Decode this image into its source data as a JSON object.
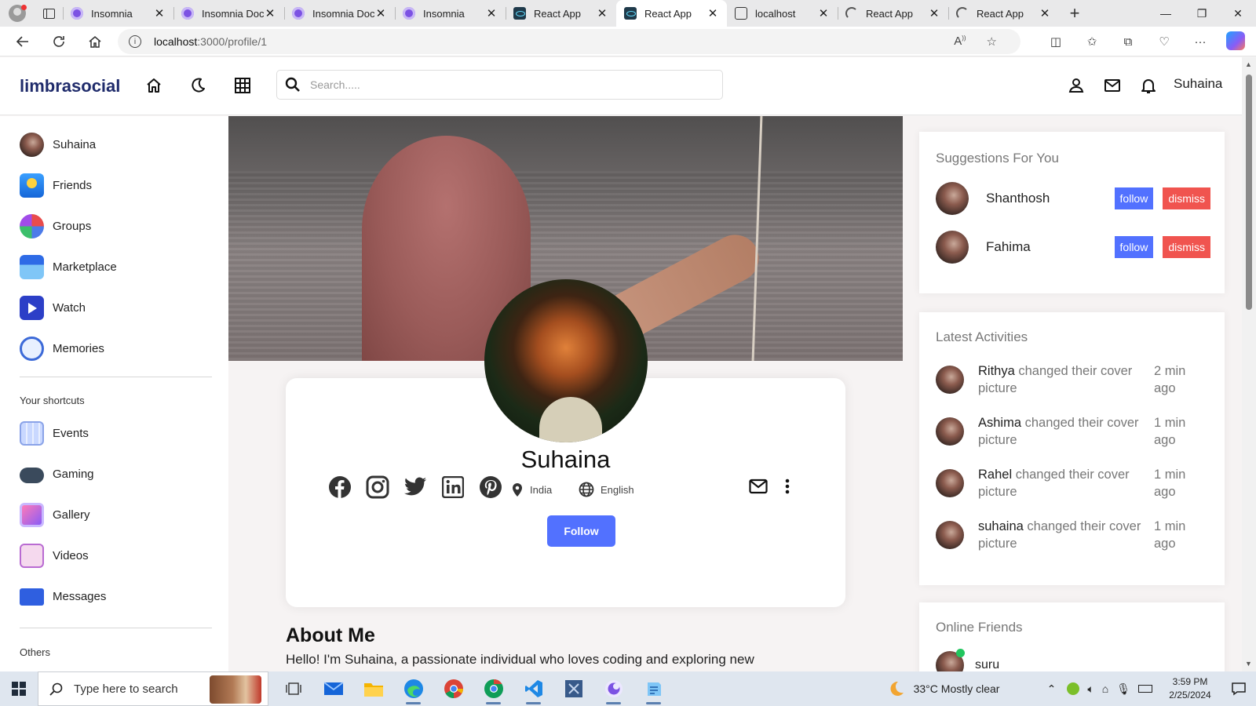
{
  "browser": {
    "tabs": [
      {
        "title": "Insomnia",
        "favicon": "insomnia-icon"
      },
      {
        "title": "Insomnia Doc",
        "favicon": "insomnia-icon"
      },
      {
        "title": "Insomnia Doc",
        "favicon": "insomnia-icon"
      },
      {
        "title": "Insomnia",
        "favicon": "insomnia-icon"
      },
      {
        "title": "React App",
        "favicon": "react-icon"
      },
      {
        "title": "React App",
        "favicon": "react-icon",
        "active": true
      },
      {
        "title": "localhost",
        "favicon": "page-icon"
      },
      {
        "title": "React App",
        "favicon": "loading-icon"
      },
      {
        "title": "React App",
        "favicon": "loading-icon"
      }
    ],
    "url_host": "localhost",
    "url_path": ":3000/profile/1"
  },
  "app": {
    "logo": "limbrasocial",
    "search_placeholder": "Search.....",
    "user_name": "Suhaina"
  },
  "sidebar": {
    "items": [
      {
        "label": "Suhaina",
        "icon": "user-avatar"
      },
      {
        "label": "Friends",
        "icon": "friends-icon"
      },
      {
        "label": "Groups",
        "icon": "groups-icon"
      },
      {
        "label": "Marketplace",
        "icon": "marketplace-icon"
      },
      {
        "label": "Watch",
        "icon": "watch-icon"
      },
      {
        "label": "Memories",
        "icon": "memories-icon"
      }
    ],
    "shortcuts_heading": "Your shortcuts",
    "shortcuts": [
      {
        "label": "Events",
        "icon": "events-icon"
      },
      {
        "label": "Gaming",
        "icon": "gaming-icon"
      },
      {
        "label": "Gallery",
        "icon": "gallery-icon"
      },
      {
        "label": "Videos",
        "icon": "videos-icon"
      },
      {
        "label": "Messages",
        "icon": "messages-icon"
      }
    ],
    "others_heading": "Others"
  },
  "profile": {
    "name": "Suhaina",
    "location": "India",
    "language": "English",
    "follow_label": "Follow",
    "about_heading": "About Me",
    "about_text": "Hello! I'm Suhaina, a passionate individual who loves coding and exploring new"
  },
  "suggestions": {
    "title": "Suggestions For You",
    "follow_label": "follow",
    "dismiss_label": "dismiss",
    "users": [
      {
        "name": "Shanthosh"
      },
      {
        "name": "Fahima"
      }
    ]
  },
  "activities": {
    "title": "Latest Activities",
    "items": [
      {
        "user": "Rithya",
        "action": " changed their cover picture",
        "time": "2 min ago"
      },
      {
        "user": "Ashima",
        "action": " changed their cover picture",
        "time": "1 min ago"
      },
      {
        "user": "Rahel",
        "action": " changed their cover picture",
        "time": "1 min ago"
      },
      {
        "user": "suhaina",
        "action": " changed their cover picture",
        "time": "1 min ago"
      }
    ]
  },
  "online": {
    "title": "Online Friends",
    "first_name": "suru"
  },
  "taskbar": {
    "search_placeholder": "Type here to search",
    "weather": "33°C  Mostly clear",
    "time": "3:59 PM",
    "date": "2/25/2024"
  },
  "colors": {
    "accent": "#5271ff",
    "dismiss": "#f0544f",
    "logo": "#1f2b6b",
    "online": "#22c55e"
  }
}
